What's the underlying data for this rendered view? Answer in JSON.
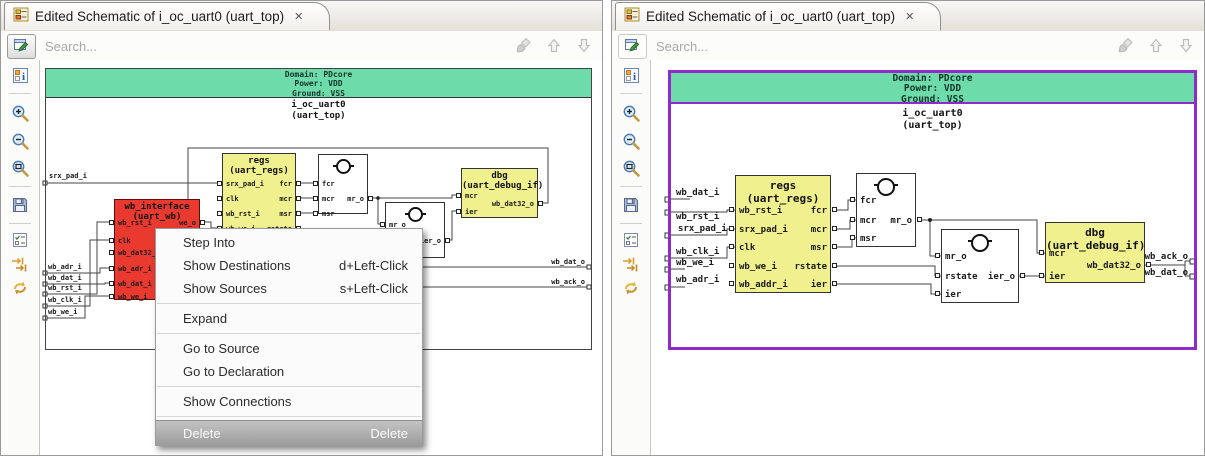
{
  "colors": {
    "header_green": "#6edbab",
    "block_yellow": "#f0f08f",
    "block_red": "#ea3a30",
    "selection_purple": "#8e2bc9",
    "menu_highlight_gray": "#a9a9a9"
  },
  "icons": {
    "tab_close": "✕",
    "tab_icon": "schematic-document",
    "search_button": "edit-search",
    "toolbar_disabled": [
      "clear-search-broom",
      "arrow-up",
      "arrow-down"
    ],
    "sidebar": [
      "properties-info",
      "zoom-in",
      "zoom-out",
      "zoom-fit",
      "save",
      "options-checklist",
      "trace-signals",
      "refresh"
    ]
  },
  "left_panel": {
    "tab": {
      "title": "Edited Schematic of i_oc_uart0 (uart_top)"
    },
    "toolbar": {
      "search_placeholder": "Search..."
    },
    "schematic": {
      "domain": "Domain: PDcore",
      "power": "Power: VDD",
      "ground": "Ground: VSS",
      "instance": "i_oc_uart0",
      "module": "(uart_top)",
      "inputs": [
        "srx_pad_i",
        "wb_adr_i",
        "wb_dat_i",
        "wb_rst_i",
        "wb_clk_i",
        "wb_we_i"
      ],
      "outputs": [
        "wb_dat_o",
        "wb_ack_o"
      ],
      "regs": {
        "name": "regs",
        "module": "(uart_regs)",
        "left": [
          "srx_pad_i",
          "clk",
          "wb_rst_i",
          "wb_we_i"
        ],
        "right": [
          "fcr",
          "mcr",
          "msr",
          "rstate"
        ]
      },
      "gate1": {
        "left": [
          "fcr",
          "mcr",
          "msr"
        ],
        "right": [
          "mr_o"
        ]
      },
      "gate2": {
        "left": [
          "mr_o"
        ],
        "right": [
          "ier_o"
        ]
      },
      "dbg": {
        "name": "dbg",
        "module": "(uart_debug_if)",
        "left": [
          "mcr",
          "ier"
        ],
        "right": [
          "wb_dat32_o"
        ]
      },
      "wb": {
        "name": "wb_interface",
        "module": "(uart_wb)",
        "left": [
          "wb_rst_i",
          "clk",
          "wb_dat32_o",
          "wb_adr_i",
          "wb_dat_i",
          "wb_we_i"
        ],
        "right": [
          "we_o"
        ]
      }
    },
    "menu": {
      "items": [
        {
          "label": "Step Into",
          "shortcut": ""
        },
        {
          "label": "Show Destinations",
          "shortcut": "d+Left-Click"
        },
        {
          "label": "Show Sources",
          "shortcut": "s+Left-Click"
        },
        {
          "label": "Expand",
          "shortcut": ""
        },
        {
          "label": "Go to Source",
          "shortcut": ""
        },
        {
          "label": "Go to Declaration",
          "shortcut": ""
        },
        {
          "label": "Show Connections",
          "shortcut": ""
        },
        {
          "label": "Delete",
          "shortcut": "Delete"
        }
      ]
    }
  },
  "right_panel": {
    "tab": {
      "title": "Edited Schematic of i_oc_uart0 (uart_top)"
    },
    "toolbar": {
      "search_placeholder": "Search..."
    },
    "schematic": {
      "domain": "Domain: PDcore",
      "power": "Power: VDD",
      "ground": "Ground: VSS",
      "instance": "i_oc_uart0",
      "module": "(uart_top)",
      "inputs": [
        "wb_dat_i",
        "wb_rst_i",
        "srx_pad_i",
        "wb_clk_i",
        "wb_we_i",
        "wb_adr_i"
      ],
      "outputs": [
        "wb_ack_o",
        "wb_dat_o"
      ],
      "regs": {
        "name": "regs",
        "module": "(uart_regs)",
        "left": [
          "wb_rst_i",
          "srx_pad_i",
          "clk",
          "wb_we_i",
          "wb_addr_i"
        ],
        "right": [
          "fcr",
          "mcr",
          "msr",
          "rstate",
          "ier"
        ]
      },
      "gate1": {
        "left": [
          "fcr",
          "mcr",
          "msr"
        ],
        "right": [
          "mr_o"
        ]
      },
      "gate2": {
        "left": [
          "mr_o",
          "rstate",
          "ier"
        ],
        "right": [
          "ier_o"
        ]
      },
      "dbg": {
        "name": "dbg",
        "module": "(uart_debug_if)",
        "left": [
          "mcr",
          "ier"
        ],
        "right": [
          "wb_dat32_o"
        ]
      }
    }
  }
}
